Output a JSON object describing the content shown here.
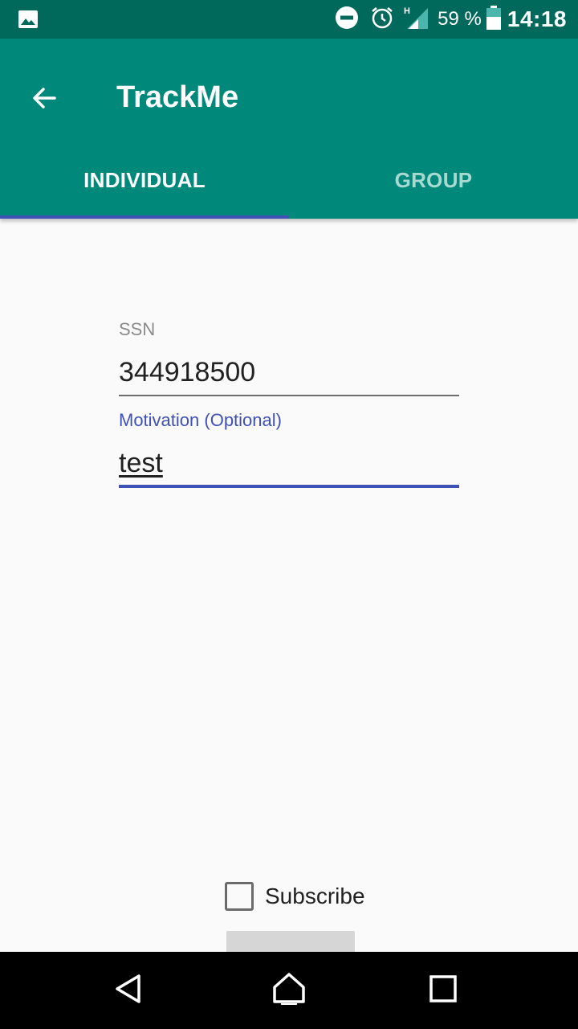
{
  "status_bar": {
    "battery_percent": "59 %",
    "time": "14:18",
    "network_type": "H",
    "icons": [
      "gallery-icon",
      "do-not-disturb-icon",
      "alarm-icon",
      "signal-icon",
      "battery-icon"
    ]
  },
  "app_bar": {
    "title": "TrackMe",
    "back_icon": "arrow-back-icon"
  },
  "tabs": [
    {
      "label": "INDIVIDUAL",
      "active": true
    },
    {
      "label": "GROUP",
      "active": false
    }
  ],
  "form": {
    "ssn": {
      "label": "SSN",
      "value": "344918500"
    },
    "motivation": {
      "label": "Motivation (Optional)",
      "value": "test"
    },
    "subscribe": {
      "label": "Subscribe",
      "checked": false
    }
  },
  "nav_bar": {
    "icons": [
      "nav-back-icon",
      "nav-home-icon",
      "nav-recents-icon"
    ]
  },
  "colors": {
    "status_bar": "#00695c",
    "app_bar": "#00897b",
    "accent": "#3f51b5",
    "tab_inactive": "#a7d8d1",
    "background": "#fafafa"
  }
}
